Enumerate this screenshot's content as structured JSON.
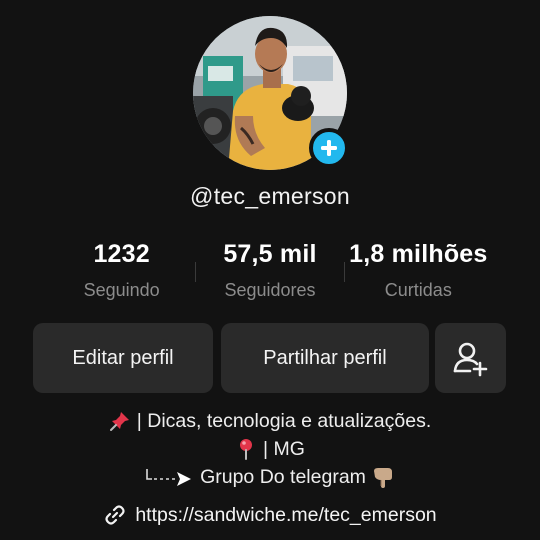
{
  "profile": {
    "username": "@tec_emerson",
    "avatar_alt": "profile-photo",
    "add_photo_icon": "plus-icon"
  },
  "stats": [
    {
      "value": "1232",
      "label": "Seguindo"
    },
    {
      "value": "57,5 mil",
      "label": "Seguidores"
    },
    {
      "value": "1,8 milhões",
      "label": "Curtidas"
    }
  ],
  "actions": {
    "edit_label": "Editar perfil",
    "share_label": "Partilhar perfil",
    "add_friend_icon": "add-friend-icon"
  },
  "bio": {
    "line1": "| Dicas, tecnologia e atualizações.",
    "line2": "| MG",
    "line3": "Grupo Do telegram"
  },
  "link": {
    "url": "https://sandwiche.me/tec_emerson",
    "icon": "link-icon"
  },
  "colors": {
    "background": "#121212",
    "button": "#2a2a2a",
    "accent": "#22b8ee",
    "muted_text": "#8c8c8c"
  }
}
